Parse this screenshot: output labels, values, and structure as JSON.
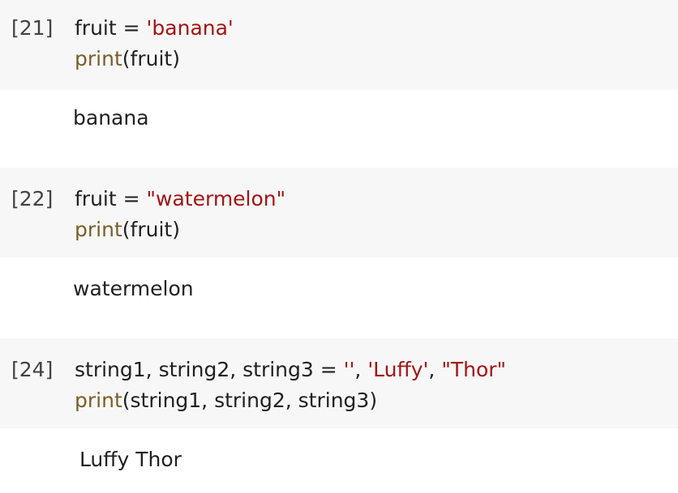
{
  "cells": [
    {
      "exec_count": "[21]",
      "code": {
        "line1": {
          "var": "fruit",
          "op": " = ",
          "str": "'banana'"
        },
        "line2": {
          "fn": "print",
          "open": "(",
          "arg": "fruit",
          "close": ")"
        }
      },
      "output": "banana"
    },
    {
      "exec_count": "[22]",
      "code": {
        "line1": {
          "var": "fruit",
          "op": " = ",
          "str": "\"watermelon\""
        },
        "line2": {
          "fn": "print",
          "open": "(",
          "arg": "fruit",
          "close": ")"
        }
      },
      "output": "watermelon"
    },
    {
      "exec_count": "[24]",
      "code": {
        "line1": {
          "vars": "string1, string2, string3",
          "op": " = ",
          "str1": "''",
          "sep1": ", ",
          "str2": "'Luffy'",
          "sep2": ", ",
          "str3": "\"Thor\""
        },
        "line2": {
          "fn": "print",
          "open": "(",
          "arg": "string1, string2, string3",
          "close": ")"
        }
      },
      "output": " Luffy Thor"
    }
  ],
  "colors": {
    "input_bg": "#f7f7f7",
    "function": "#795e26",
    "string": "#a31515",
    "text": "#212121"
  }
}
